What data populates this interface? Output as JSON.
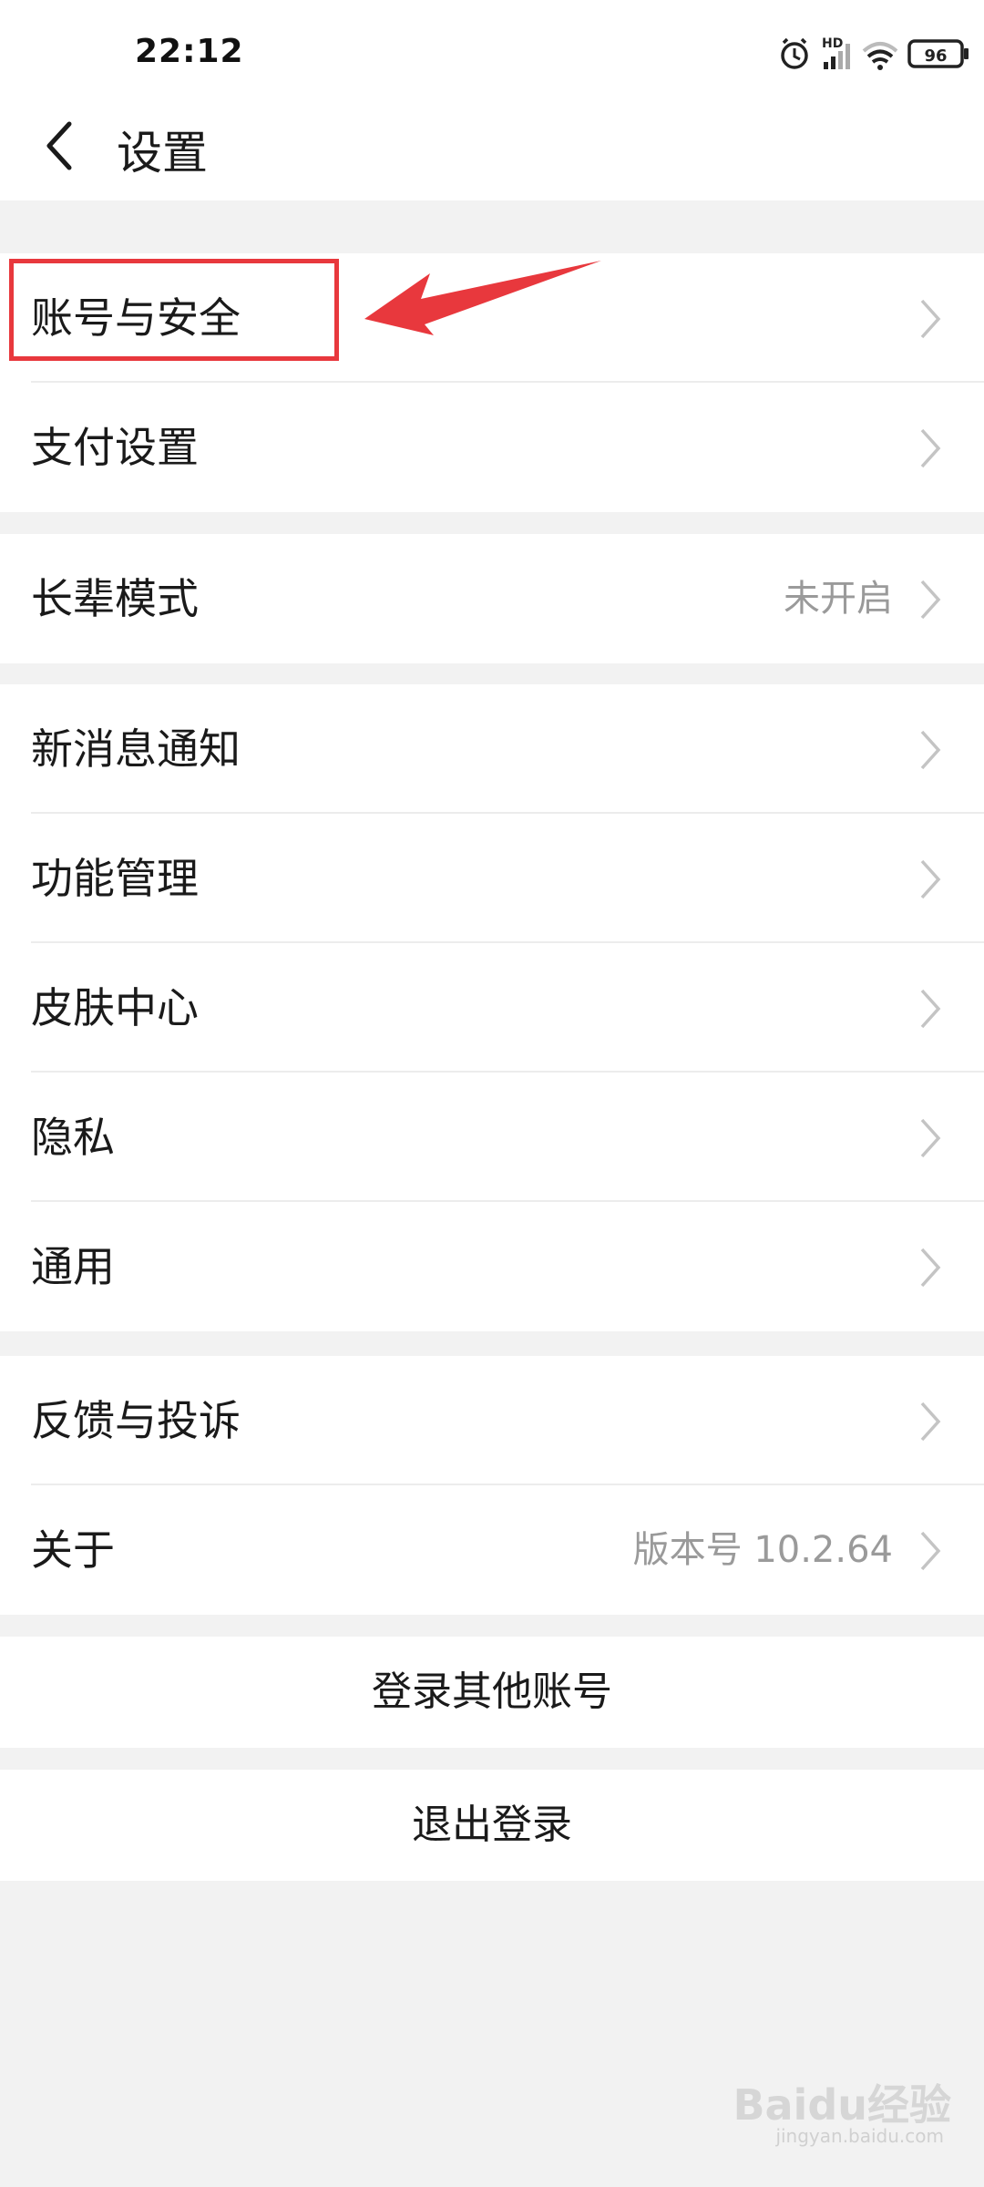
{
  "status_bar": {
    "time": "22:12",
    "network_label": "HD",
    "battery": "96",
    "icons": [
      "alarm-icon",
      "signal-icon",
      "wifi-icon",
      "battery-icon"
    ]
  },
  "header": {
    "title": "设置",
    "back_icon": "back-arrow-icon"
  },
  "groups": [
    {
      "items": [
        {
          "label": "账号与安全",
          "value": ""
        },
        {
          "label": "支付设置",
          "value": ""
        }
      ]
    },
    {
      "items": [
        {
          "label": "长辈模式",
          "value": "未开启"
        }
      ]
    },
    {
      "items": [
        {
          "label": "新消息通知",
          "value": ""
        },
        {
          "label": "功能管理",
          "value": ""
        },
        {
          "label": "皮肤中心",
          "value": ""
        },
        {
          "label": "隐私",
          "value": ""
        },
        {
          "label": "通用",
          "value": ""
        }
      ]
    },
    {
      "items": [
        {
          "label": "反馈与投诉",
          "value": ""
        },
        {
          "label": "关于",
          "value": "版本号 10.2.64"
        }
      ]
    }
  ],
  "actions": {
    "login_other": "登录其他账号",
    "logout": "退出登录"
  },
  "annotation": {
    "highlight_color": "#e8383d"
  },
  "watermark": {
    "brand": "Baidu经验",
    "url": "jingyan.baidu.com"
  }
}
